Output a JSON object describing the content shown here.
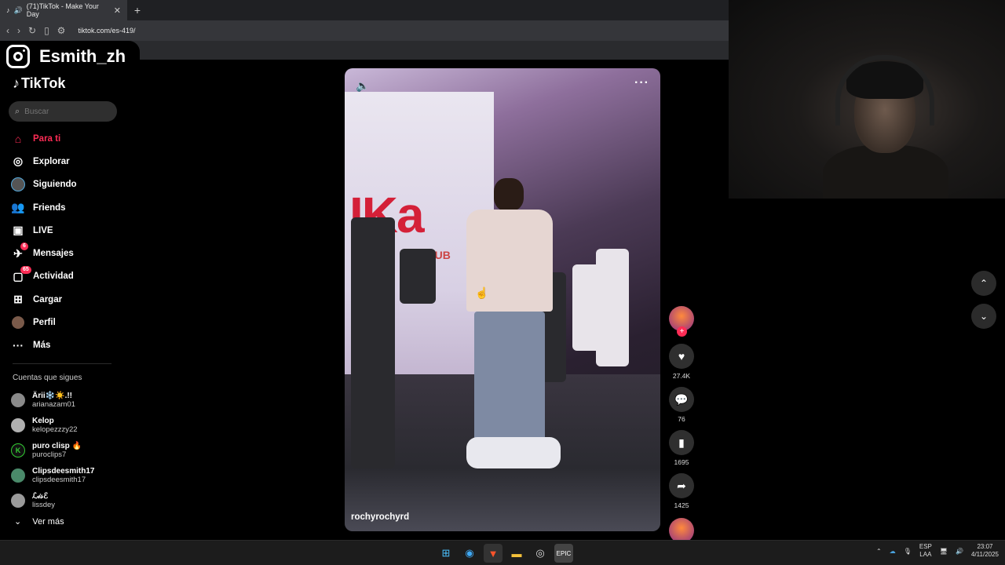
{
  "browser": {
    "tab_title": "(71)TikTok - Make Your Day",
    "tab_close": "✕",
    "new_tab": "+",
    "url": "tiktok.com/es-419/"
  },
  "overlay": {
    "instagram_handle": "Esmith_zh"
  },
  "sidebar": {
    "logo": "TikTok",
    "search_placeholder": "Buscar",
    "nav": [
      {
        "label": "Para ti",
        "icon": "home-icon",
        "active": true
      },
      {
        "label": "Explorar",
        "icon": "compass-icon"
      },
      {
        "label": "Siguiendo",
        "icon": "following-avatar-icon"
      },
      {
        "label": "Friends",
        "icon": "friends-icon"
      },
      {
        "label": "LIVE",
        "icon": "live-icon"
      },
      {
        "label": "Mensajes",
        "icon": "messages-icon",
        "badge": "6"
      },
      {
        "label": "Actividad",
        "icon": "activity-icon",
        "badge": "65"
      },
      {
        "label": "Cargar",
        "icon": "upload-icon"
      },
      {
        "label": "Perfil",
        "icon": "profile-avatar-icon"
      },
      {
        "label": "Más",
        "icon": "more-dots-icon"
      }
    ],
    "following_title": "Cuentas que sigues",
    "accounts": [
      {
        "name": "Ärii❄️☀️.!!",
        "user": "arianazam01"
      },
      {
        "name": "Kelop",
        "user": "kelopezzzy22"
      },
      {
        "name": "puro clisp 🔥",
        "user": "puroclips7"
      },
      {
        "name": "Clipsdeesmith17",
        "user": "clipsdeesmith17"
      },
      {
        "name": "ℒ𝒾𝓈ℰ",
        "user": "lissdey"
      }
    ],
    "see_more": "Ver más"
  },
  "video": {
    "author": "rochyrochyrd",
    "screen_text": "IKa",
    "screen_sub": "CLUB"
  },
  "actions": {
    "plus": "+",
    "likes": "27.4K",
    "comments": "76",
    "saves": "1695",
    "shares": "1425"
  },
  "taskbar": {
    "lang_top": "ESP",
    "lang_bottom": "LAA",
    "time": "23:07",
    "date": "4/11/2025"
  }
}
